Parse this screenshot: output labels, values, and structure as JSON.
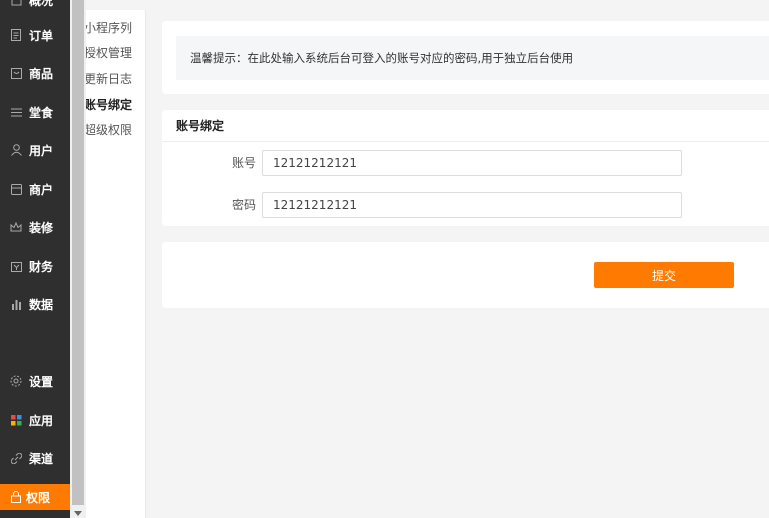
{
  "sidebar": {
    "items": [
      {
        "label": "概况",
        "icon": "home-icon"
      },
      {
        "label": "订单",
        "icon": "order-icon"
      },
      {
        "label": "商品",
        "icon": "goods-icon"
      },
      {
        "label": "堂食",
        "icon": "menu-lines-icon"
      },
      {
        "label": "用户",
        "icon": "user-icon"
      },
      {
        "label": "商户",
        "icon": "shop-icon"
      },
      {
        "label": "装修",
        "icon": "crown-icon"
      },
      {
        "label": "财务",
        "icon": "wallet-icon"
      },
      {
        "label": "数据",
        "icon": "bar-chart-icon"
      },
      {
        "label": "设置",
        "icon": "gear-icon"
      },
      {
        "label": "应用",
        "icon": "apps-icon"
      },
      {
        "label": "渠道",
        "icon": "link-icon"
      },
      {
        "label": "权限",
        "icon": "lock-icon",
        "active": true
      }
    ]
  },
  "submenu": {
    "items": [
      {
        "label": "小程序列"
      },
      {
        "label": "授权管理"
      },
      {
        "label": "更新日志"
      },
      {
        "label": "账号绑定",
        "active": true
      },
      {
        "label": "超级权限"
      }
    ]
  },
  "tip": {
    "text": "温馨提示：在此处输入系统后台可登入的账号对应的密码,用于独立后台使用"
  },
  "bind": {
    "title": "账号绑定",
    "account_label": "账号",
    "account_value": "12121212121",
    "password_label": "密码",
    "password_value": "12121212121"
  },
  "submit": {
    "label": "提交"
  },
  "colors": {
    "accent": "#ff7a00",
    "sidebar_bg": "#2f2f2f"
  }
}
